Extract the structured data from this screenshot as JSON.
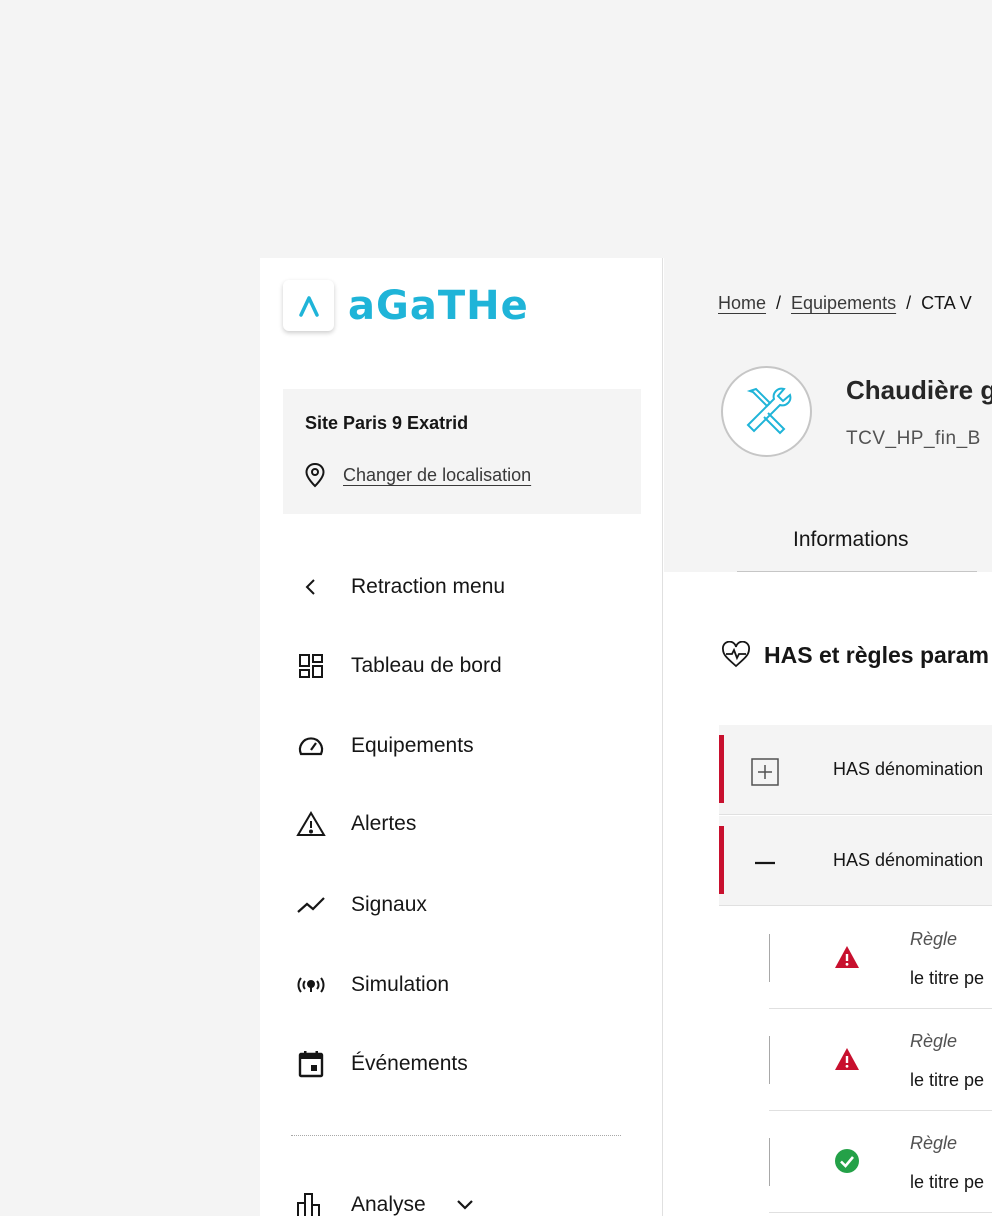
{
  "app": {
    "logo_text": "aGaTHe",
    "brand_color": "#1fb4d8",
    "alert_color": "#c8102e",
    "ok_color": "#24a148"
  },
  "site": {
    "name": "Site Paris 9 Exatrid",
    "change_label": "Changer de localisation"
  },
  "sidebar": {
    "items": [
      {
        "label": "Retraction menu",
        "icon": "chevron-left-icon"
      },
      {
        "label": "Tableau de bord",
        "icon": "dashboard-icon"
      },
      {
        "label": "Equipements",
        "icon": "gauge-icon"
      },
      {
        "label": "Alertes",
        "icon": "warning-icon"
      },
      {
        "label": "Signaux",
        "icon": "chart-line-icon"
      },
      {
        "label": "Simulation",
        "icon": "broadcast-icon"
      },
      {
        "label": "Événements",
        "icon": "calendar-icon"
      },
      {
        "label": "Analyse",
        "icon": "bar-chart-icon"
      }
    ]
  },
  "breadcrumb": {
    "home": "Home",
    "sep": "/",
    "equipements": "Equipements",
    "current": "CTA V"
  },
  "equipment": {
    "title": "Chaudière g",
    "subtitle": "TCV_HP_fin_B",
    "icon": "tools-icon"
  },
  "tabs": {
    "informations": "Informations"
  },
  "section": {
    "title": "HAS et règles param",
    "icon": "heart-pulse-icon"
  },
  "has_rows": [
    {
      "label": "HAS dénomination",
      "expanded": false
    },
    {
      "label": "HAS dénomination",
      "expanded": true
    }
  ],
  "rules": [
    {
      "kind": "Règle",
      "title": "le titre pe",
      "status": "alert"
    },
    {
      "kind": "Règle",
      "title": "le titre pe",
      "status": "alert"
    },
    {
      "kind": "Règle",
      "title": "le titre pe",
      "status": "ok"
    }
  ]
}
